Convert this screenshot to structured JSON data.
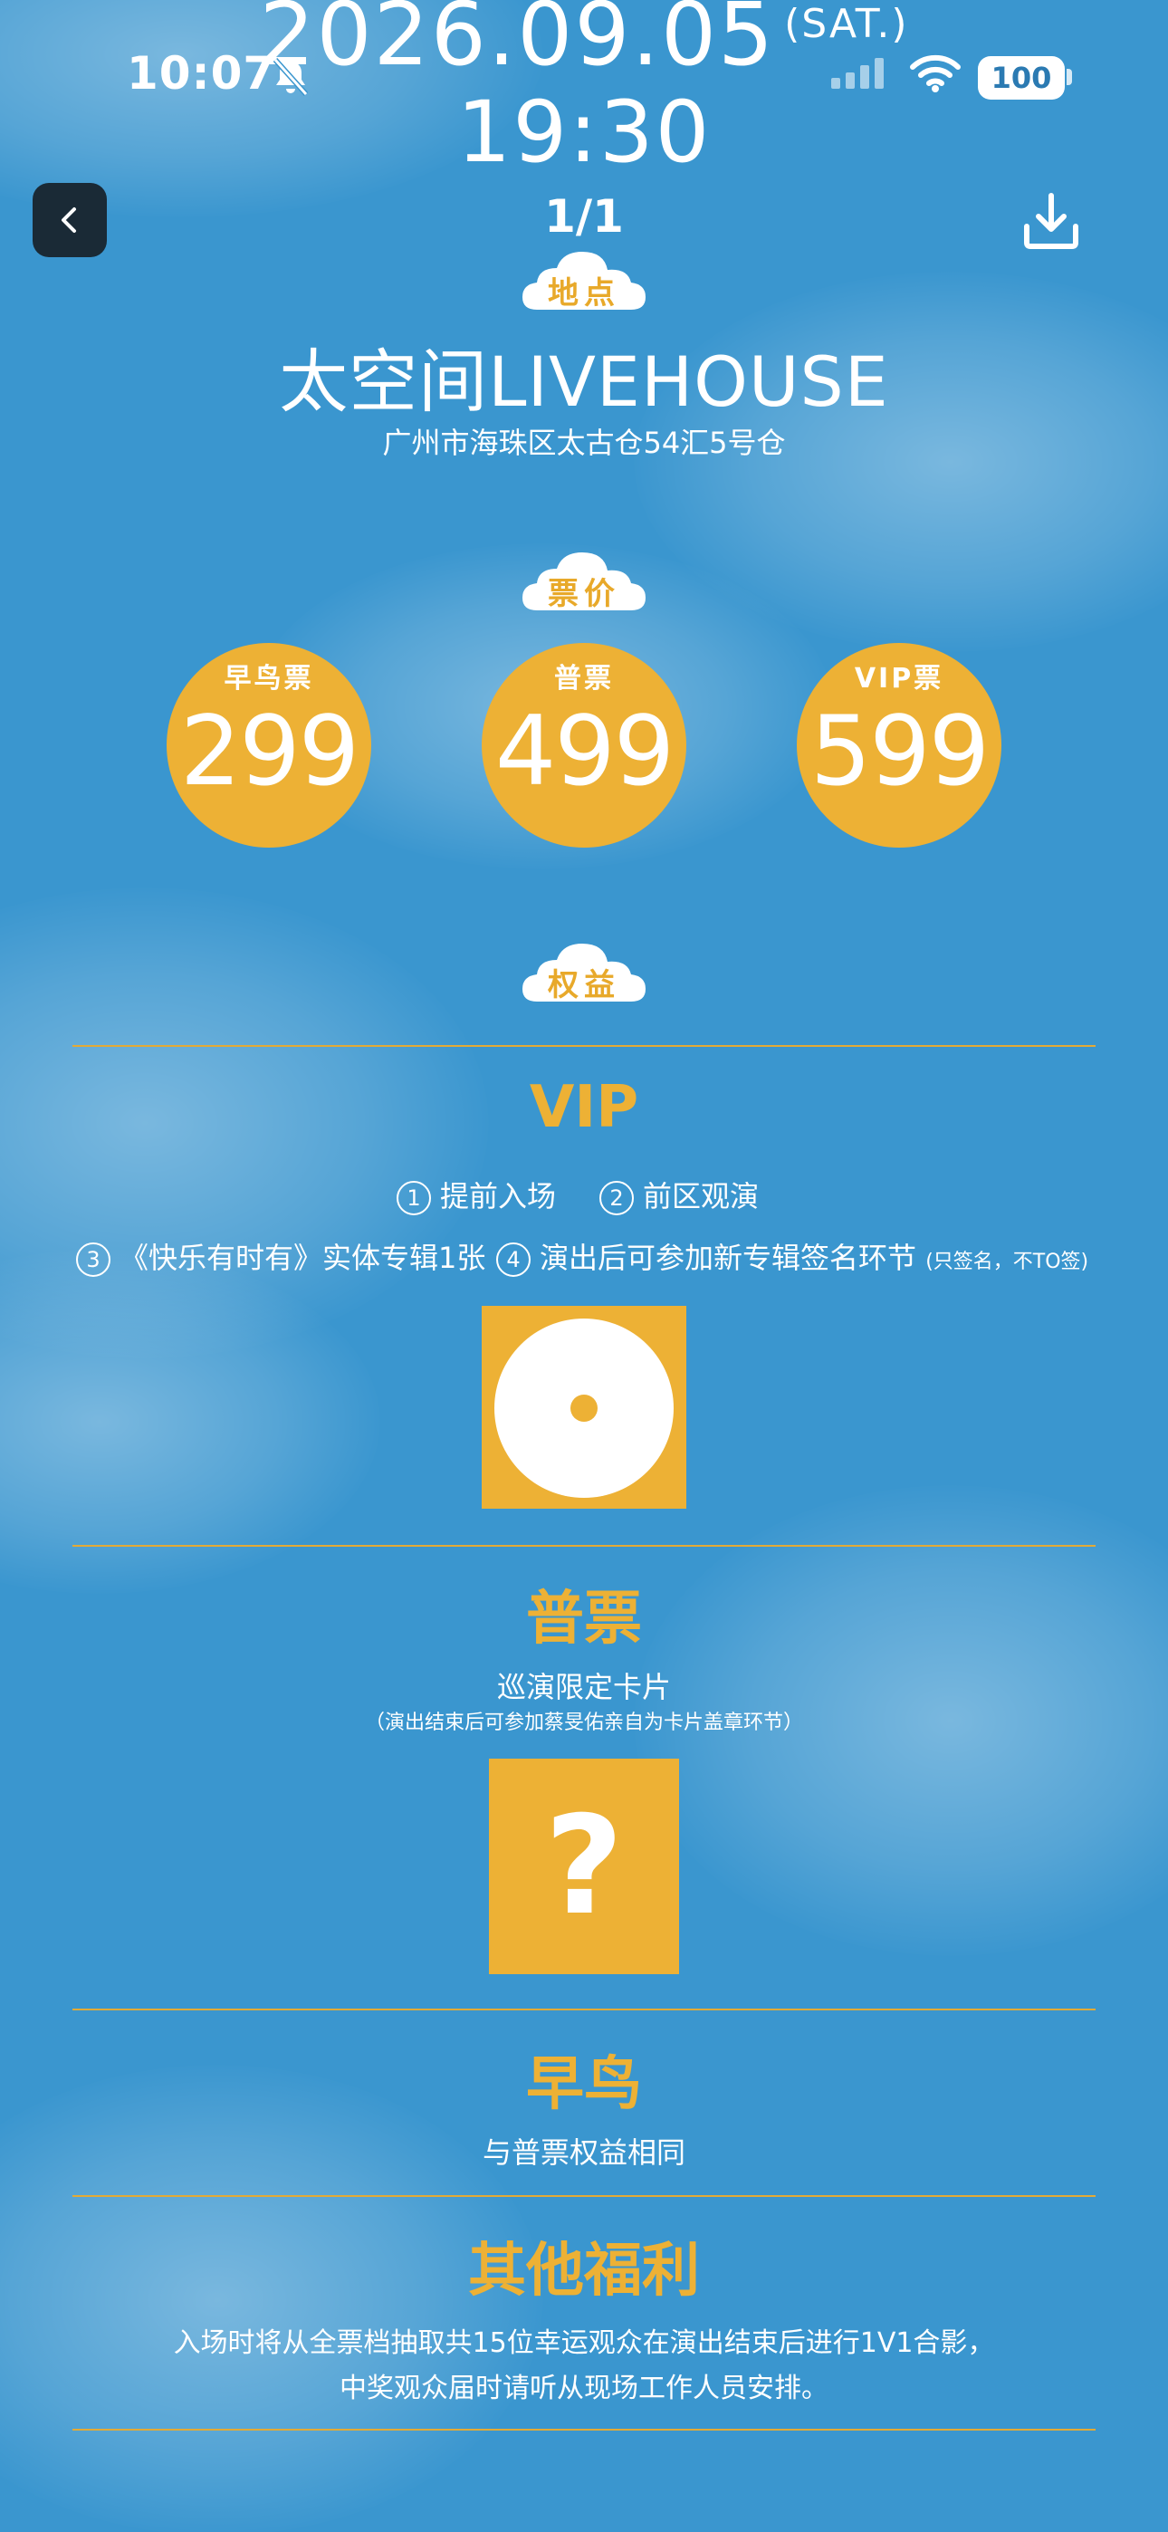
{
  "status": {
    "time": "10:07",
    "battery": "100"
  },
  "event": {
    "date": "2026.09.05",
    "weekday": "(SAT.)",
    "time": "19:30"
  },
  "nav": {
    "pager": "1/1"
  },
  "location": {
    "tag": "地点",
    "venue": "太空间LIVEHOUSE",
    "address": "广州市海珠区太古仓54汇5号仓"
  },
  "pricing": {
    "tag": "票价",
    "tiers": [
      {
        "label": "早鸟票",
        "price": "299"
      },
      {
        "label": "普票",
        "price": "499"
      },
      {
        "label": "VIP票",
        "price": "599"
      }
    ]
  },
  "benefits": {
    "tag": "权益",
    "vip": {
      "title": "VIP",
      "items": [
        {
          "num": "1",
          "text": "提前入场"
        },
        {
          "num": "2",
          "text": "前区观演"
        },
        {
          "num": "3",
          "text": "《快乐有时有》实体专辑1张"
        },
        {
          "num": "4",
          "text": "演出后可参加新专辑签名环节"
        }
      ],
      "note": "(只签名，不TO签)"
    },
    "regular": {
      "title": "普票",
      "item": "巡演限定卡片",
      "note": "（演出结束后可参加蔡旻佑亲自为卡片盖章环节）",
      "placeholder": "?"
    },
    "early": {
      "title": "早鸟",
      "text": "与普票权益相同"
    },
    "other": {
      "title": "其他福利",
      "line1": "入场时将从全票档抽取共15位幸运观众在演出结束后进行1V1合影，",
      "line2": "中奖观众届时请听从现场工作人员安排。"
    }
  },
  "colors": {
    "background": "#3a96cf",
    "accent": "#edb135",
    "text": "#ffffff"
  },
  "icons": [
    "bell-slash-icon",
    "signal-icon",
    "wifi-icon",
    "back-icon",
    "download-icon",
    "cloud-icon",
    "disc-icon"
  ]
}
